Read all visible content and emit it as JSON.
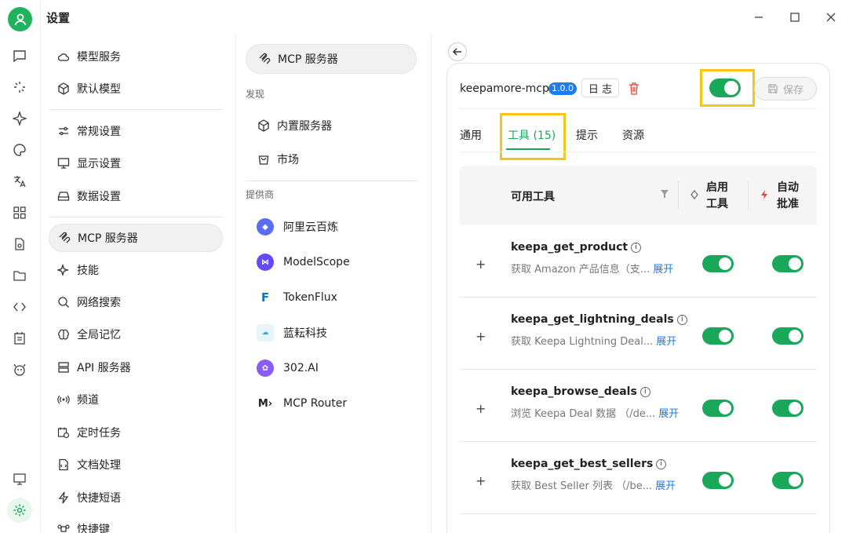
{
  "app": {
    "title": "设置"
  },
  "rail": {
    "icons": [
      "avatar-icon",
      "chat-icon",
      "agents-icon",
      "sparkle-icon",
      "palette-icon",
      "translate-icon",
      "apps-icon",
      "files-icon",
      "folder-icon",
      "code-icon",
      "notes-icon",
      "mascot-icon",
      "monitor-icon",
      "settings-icon"
    ]
  },
  "sidebar": {
    "items": [
      {
        "label": "模型服务",
        "icon": "cloud-icon"
      },
      {
        "label": "默认模型",
        "icon": "cube-icon"
      },
      {
        "label": "常规设置",
        "icon": "sliders-icon"
      },
      {
        "label": "显示设置",
        "icon": "display-icon"
      },
      {
        "label": "数据设置",
        "icon": "storage-icon"
      },
      {
        "label": "MCP 服务器",
        "icon": "mcp-icon"
      },
      {
        "label": "技能",
        "icon": "sparkle-icon"
      },
      {
        "label": "网络搜索",
        "icon": "search-icon"
      },
      {
        "label": "全局记忆",
        "icon": "brain-icon"
      },
      {
        "label": "API 服务器",
        "icon": "server-icon"
      },
      {
        "label": "频道",
        "icon": "broadcast-icon"
      },
      {
        "label": "定时任务",
        "icon": "calendar-clock-icon"
      },
      {
        "label": "文档处理",
        "icon": "document-icon"
      },
      {
        "label": "快捷短语",
        "icon": "lightning-icon"
      },
      {
        "label": "快捷键",
        "icon": "command-icon"
      }
    ]
  },
  "mcp": {
    "header": "MCP 服务器",
    "discover_label": "发现",
    "builtin": "内置服务器",
    "market": "市场",
    "providers_label": "提供商",
    "providers": [
      {
        "name": "阿里云百炼",
        "color": "#5b6cf0"
      },
      {
        "name": "ModelScope",
        "color": "#624aff"
      },
      {
        "name": "TokenFlux",
        "color": "#0d7ab8"
      },
      {
        "name": "蓝耘科技",
        "color": "#3aa7d9"
      },
      {
        "name": "302.AI",
        "color": "#8a5cf6"
      },
      {
        "name": "MCP Router",
        "color": "#222222"
      }
    ]
  },
  "server": {
    "name": "keepamore-mcp",
    "version": "1.0.0",
    "log_label": "日 志",
    "enabled": true,
    "save_label": "保存",
    "tabs": [
      "通用",
      "工具 (15)",
      "提示",
      "资源"
    ],
    "active_tab": "工具 (15)",
    "table": {
      "col_tools": "可用工具",
      "col_enable_1": "启用",
      "col_enable_2": "工具",
      "col_auto_1": "自动",
      "col_auto_2": "批准"
    },
    "tools": [
      {
        "name": "keepa_get_product",
        "desc": "获取 Amazon 产品信息（支...",
        "expand": "展开",
        "enabled": true,
        "auto": true
      },
      {
        "name": "keepa_get_lightning_deals",
        "desc": "获取 Keepa Lightning Deal...",
        "expand": "展开",
        "enabled": true,
        "auto": true
      },
      {
        "name": "keepa_browse_deals",
        "desc": "浏览 Keepa Deal 数据 （/de...",
        "expand": "展开",
        "enabled": true,
        "auto": true
      },
      {
        "name": "keepa_get_best_sellers",
        "desc": "获取 Best Seller 列表 （/be...",
        "expand": "展开",
        "enabled": true,
        "auto": true
      }
    ]
  },
  "colors": {
    "accent": "#19a85a",
    "highlight": "#f5c518",
    "link": "#1e7bf0",
    "danger": "#e0483d"
  }
}
